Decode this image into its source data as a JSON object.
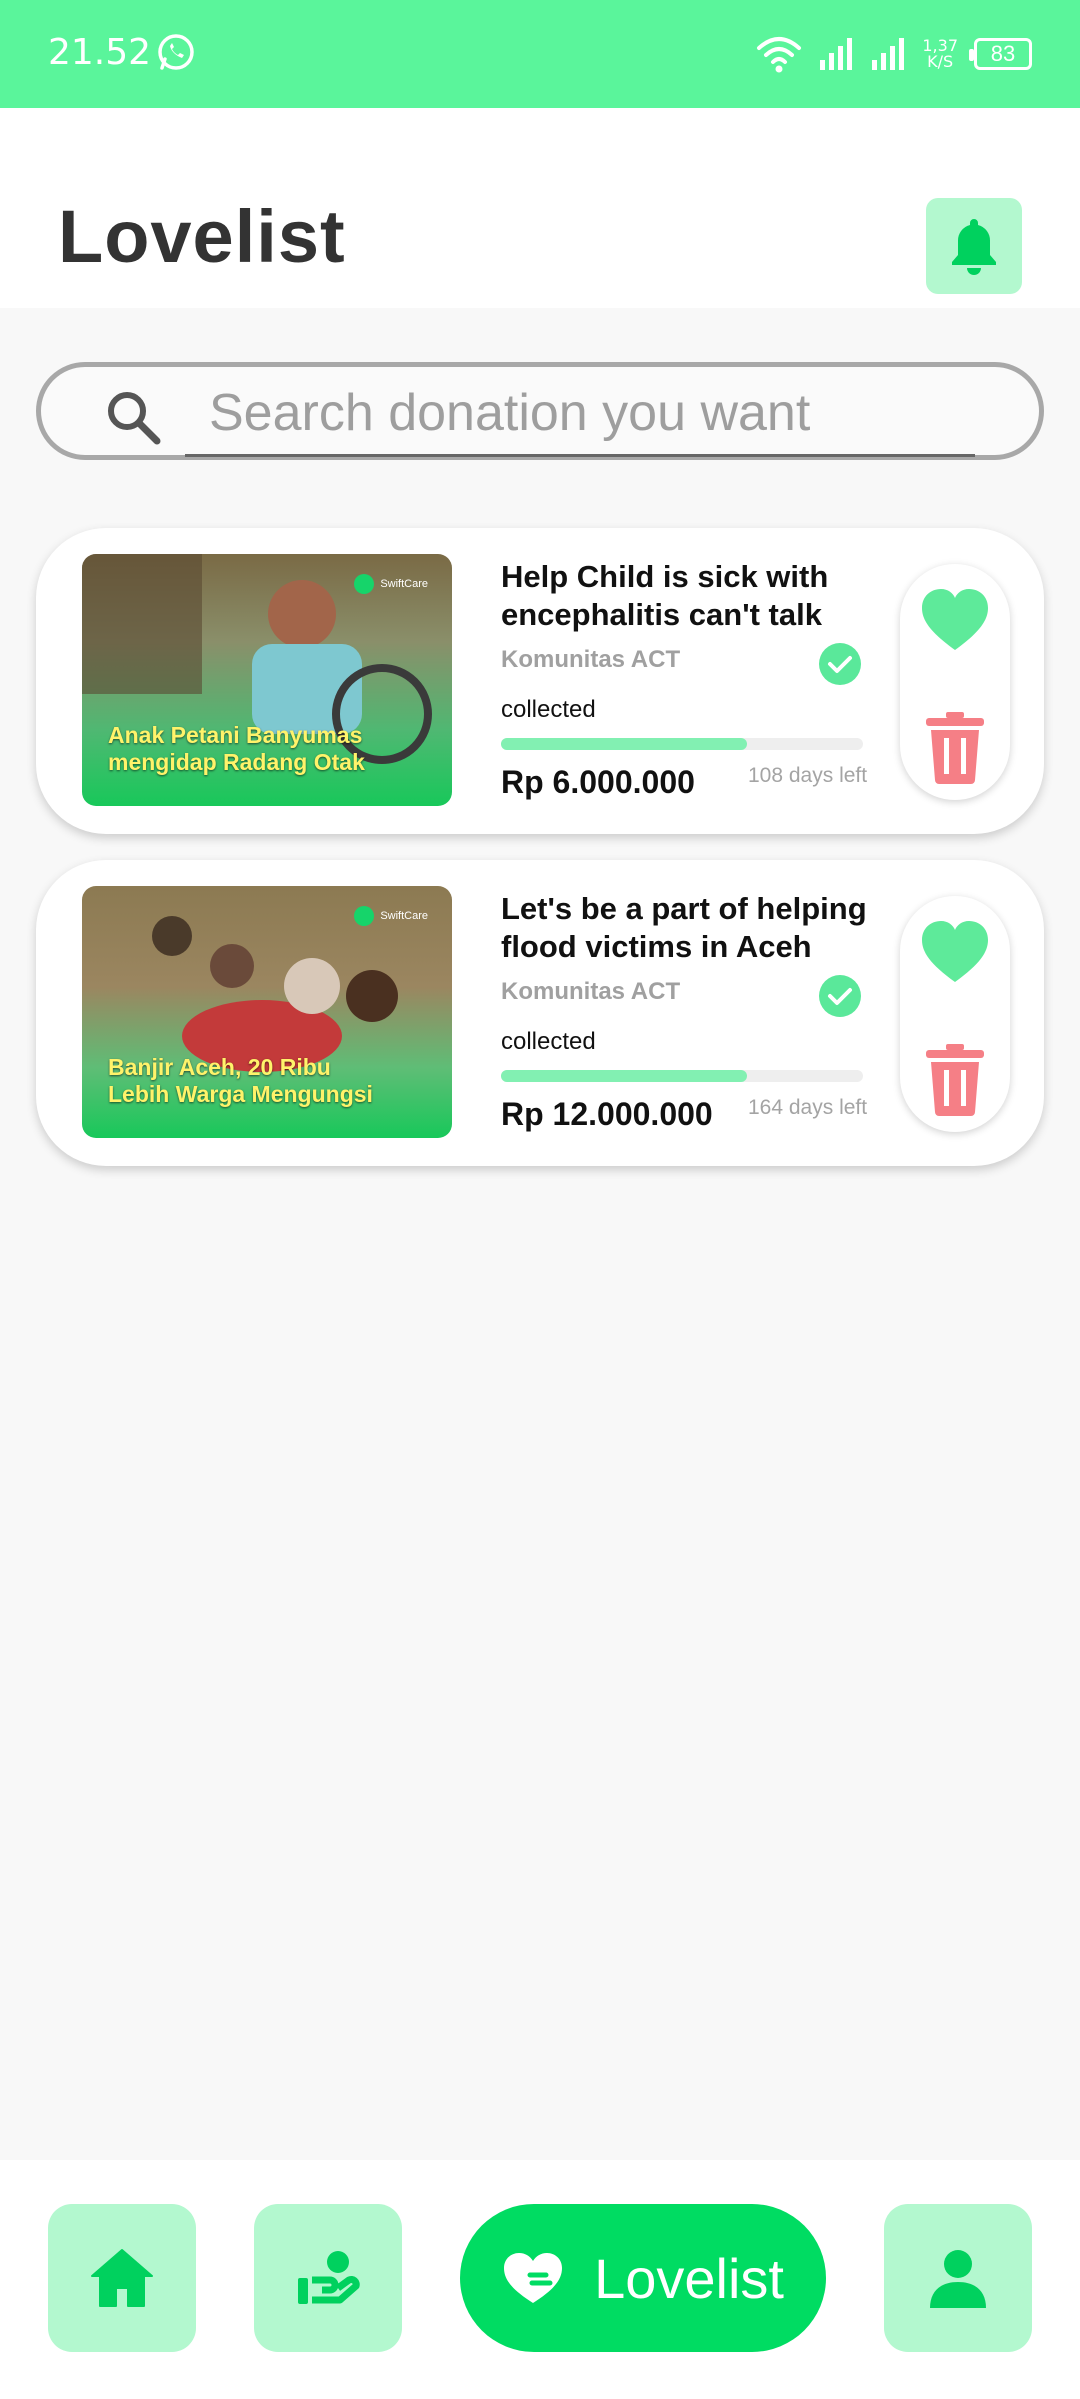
{
  "status": {
    "time": "21.52",
    "net_speed_value": "1,37",
    "net_speed_unit": "K/S",
    "battery": "83"
  },
  "header": {
    "title": "Lovelist"
  },
  "search": {
    "placeholder": "Search donation you want"
  },
  "cards": [
    {
      "thumb_text_line1": "Anak Petani Banyumas",
      "thumb_text_line2": "mengidap Radang Otak",
      "thumb_brand": "SwiftCare",
      "title": "Help Child is sick with encephalitis can't talk",
      "organization": "Komunitas ACT",
      "collected_label": "collected",
      "progress": 0.68,
      "amount": "Rp 6.000.000",
      "days_left": "108 days left"
    },
    {
      "thumb_text_line1": "Banjir Aceh, 20 Ribu",
      "thumb_text_line2": "Lebih Warga Mengungsi",
      "thumb_brand": "SwiftCare",
      "title": "Let's be a part of helping flood victims in Aceh",
      "organization": "Komunitas ACT",
      "collected_label": "collected",
      "progress": 0.68,
      "amount": "Rp 12.000.000",
      "days_left": "164 days left"
    }
  ],
  "nav": {
    "home_icon": "home-icon",
    "donate_icon": "donate-hand-icon",
    "active_label": "Lovelist",
    "profile_icon": "person-icon"
  },
  "colors": {
    "accent": "#00dc62",
    "accent_light": "#b3f8cf",
    "status_bar": "#5af59b",
    "heart": "#5eea9a",
    "trash": "#f57f86"
  }
}
